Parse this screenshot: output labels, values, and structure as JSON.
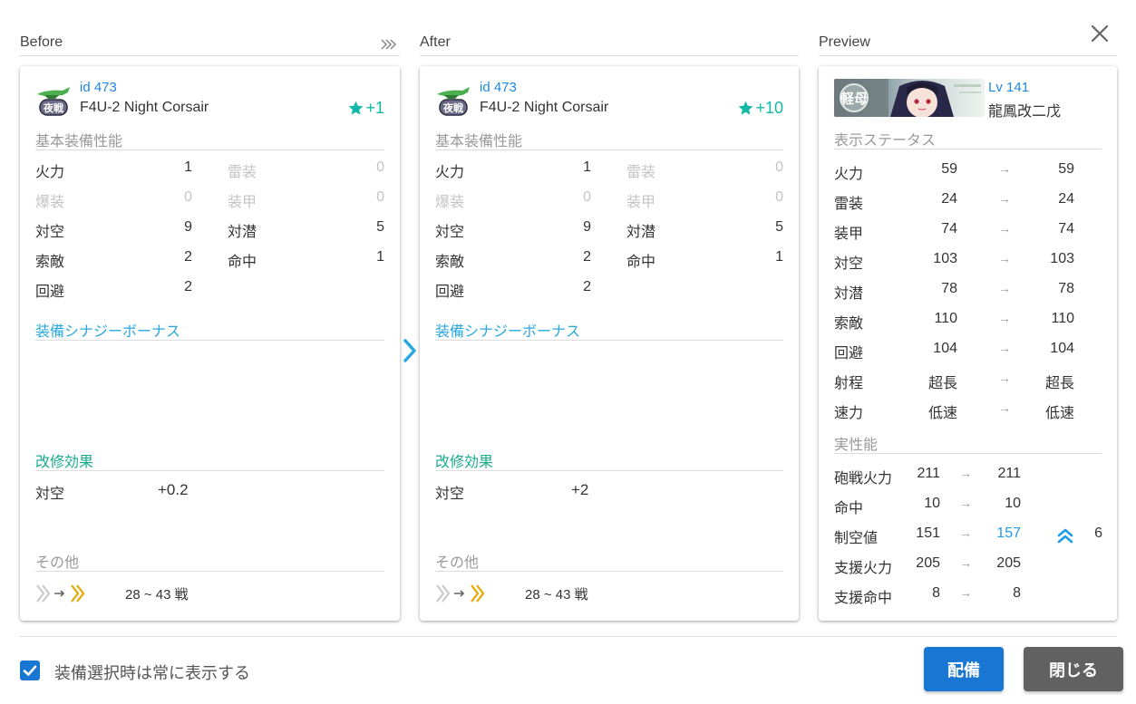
{
  "headers": {
    "before": "Before",
    "after": "After",
    "preview": "Preview"
  },
  "before": {
    "id": "id 473",
    "name": "F4U-2 Night Corsair",
    "level": "+1",
    "icon_text": "夜戦",
    "sections": {
      "base": "基本装備性能",
      "synergy": "装備シナジーボーナス",
      "improve": "改修効果",
      "other": "その他"
    },
    "stats_left": [
      {
        "label": "火力",
        "value": "1",
        "dim": false
      },
      {
        "label": "爆装",
        "value": "0",
        "dim": true
      },
      {
        "label": "対空",
        "value": "9",
        "dim": false
      },
      {
        "label": "索敵",
        "value": "2",
        "dim": false
      },
      {
        "label": "回避",
        "value": "2",
        "dim": false
      }
    ],
    "stats_right": [
      {
        "label": "雷装",
        "value": "0",
        "dim": true
      },
      {
        "label": "装甲",
        "value": "0",
        "dim": true
      },
      {
        "label": "対潜",
        "value": "5",
        "dim": false
      },
      {
        "label": "命中",
        "value": "1",
        "dim": false
      }
    ],
    "improve": {
      "label": "対空",
      "value": "+0.2"
    },
    "battles": "28 ~ 43 戦"
  },
  "after": {
    "id": "id 473",
    "name": "F4U-2 Night Corsair",
    "level": "+10",
    "icon_text": "夜戦",
    "sections": {
      "base": "基本装備性能",
      "synergy": "装備シナジーボーナス",
      "improve": "改修効果",
      "other": "その他"
    },
    "stats_left": [
      {
        "label": "火力",
        "value": "1",
        "dim": false
      },
      {
        "label": "爆装",
        "value": "0",
        "dim": true
      },
      {
        "label": "対空",
        "value": "9",
        "dim": false
      },
      {
        "label": "索敵",
        "value": "2",
        "dim": false
      },
      {
        "label": "回避",
        "value": "2",
        "dim": false
      }
    ],
    "stats_right": [
      {
        "label": "雷装",
        "value": "0",
        "dim": true
      },
      {
        "label": "装甲",
        "value": "0",
        "dim": true
      },
      {
        "label": "対潜",
        "value": "5",
        "dim": false
      },
      {
        "label": "命中",
        "value": "1",
        "dim": false
      }
    ],
    "improve": {
      "label": "対空",
      "value": "+2"
    },
    "battles": "28 ~ 43 戦"
  },
  "preview": {
    "level": "Lv 141",
    "ship_name": "龍鳳改二戊",
    "banner_badge": "軽母",
    "sections": {
      "display": "表示ステータス",
      "actual": "実性能"
    },
    "arrow": "→",
    "status": [
      {
        "label": "火力",
        "before": "59",
        "after": "59"
      },
      {
        "label": "雷装",
        "before": "24",
        "after": "24"
      },
      {
        "label": "装甲",
        "before": "74",
        "after": "74"
      },
      {
        "label": "対空",
        "before": "103",
        "after": "103"
      },
      {
        "label": "対潜",
        "before": "78",
        "after": "78"
      },
      {
        "label": "索敵",
        "before": "110",
        "after": "110"
      },
      {
        "label": "回避",
        "before": "104",
        "after": "104"
      },
      {
        "label": "射程",
        "before": "超長",
        "after": "超長"
      },
      {
        "label": "速力",
        "before": "低速",
        "after": "低速"
      }
    ],
    "actual": [
      {
        "label": "砲戦火力",
        "before": "211",
        "after": "211",
        "diff": ""
      },
      {
        "label": "命中",
        "before": "10",
        "after": "10",
        "diff": ""
      },
      {
        "label": "制空値",
        "before": "151",
        "after": "157",
        "diff": "6"
      },
      {
        "label": "支援火力",
        "before": "205",
        "after": "205",
        "diff": ""
      },
      {
        "label": "支援命中",
        "before": "8",
        "after": "8",
        "diff": ""
      }
    ]
  },
  "footer": {
    "checkbox_label": "装備選択時は常に表示する",
    "checkbox_checked": true,
    "equip_button": "配備",
    "close_button": "閉じる"
  },
  "colors": {
    "accent_blue": "#1976d2",
    "link_blue": "#1e88e5",
    "teal": "#12b8a6",
    "synergy_blue": "#29a8e0",
    "improve_green": "#19ab8c",
    "close_grey": "#616161",
    "fatigue_gold": "#e6a700"
  },
  "icons": [
    "close-icon",
    "double-chevron-icon",
    "night-fighter-icon",
    "star-icon",
    "chevron-right-icon",
    "fatigue-arrow-icon",
    "double-up-chevron-icon",
    "checkbox-checked-icon"
  ]
}
